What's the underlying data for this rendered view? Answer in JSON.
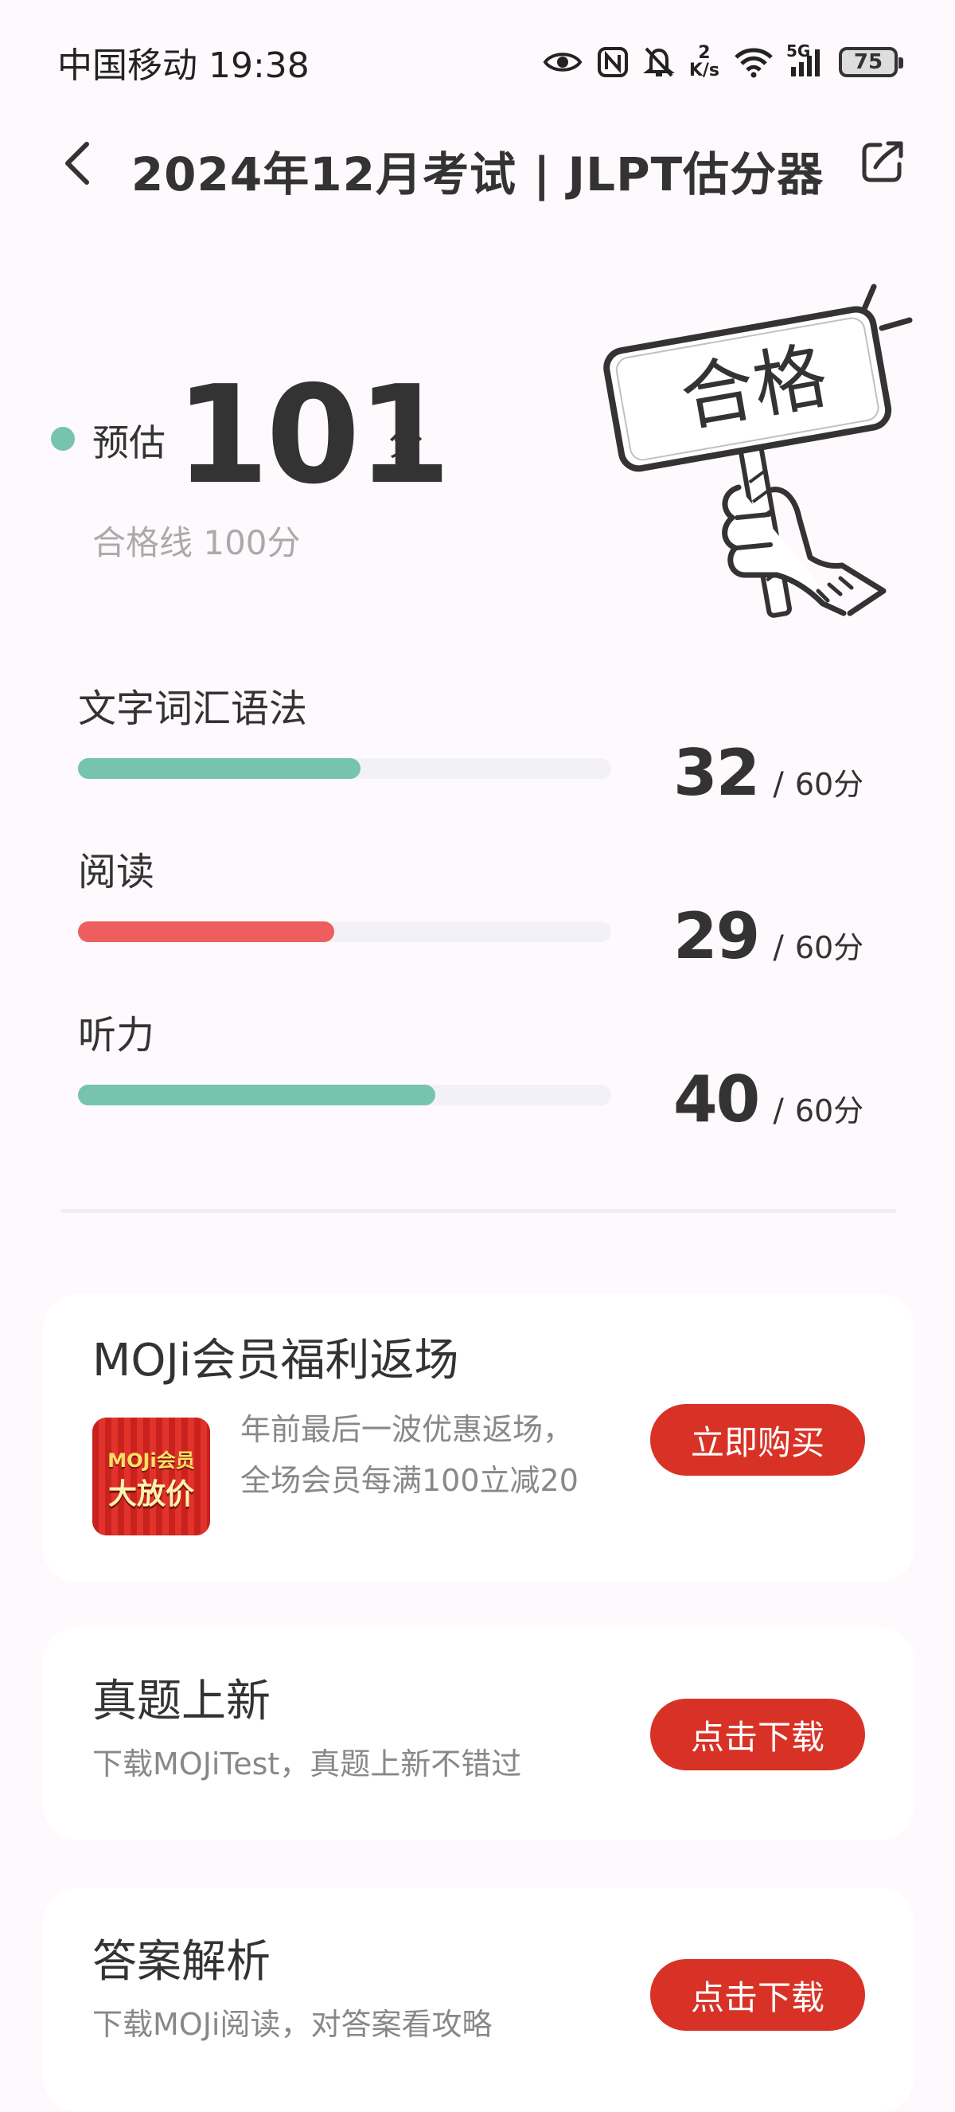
{
  "status_bar": {
    "carrier_time": "中国移动 19:38",
    "net_speed_value": "2",
    "net_speed_unit": "K/s",
    "signal_type": "5G",
    "battery": "75",
    "icons": [
      "eye-icon",
      "nfc-icon",
      "bell-off-icon",
      "wifi-icon",
      "signal-icon",
      "battery-icon"
    ]
  },
  "nav": {
    "title": "2024年12月考试 | JLPT估分器",
    "icons": [
      "back-arrow-icon",
      "share-icon"
    ]
  },
  "score": {
    "prefix": "预估",
    "value": "101",
    "unit": "分",
    "pass_line": "合格线 100分",
    "sign_text": "合格"
  },
  "sections": [
    {
      "name": "文字词汇语法",
      "score": "32",
      "max": "60分",
      "fraction": 0.53,
      "color": "#76c4ad"
    },
    {
      "name": "阅读",
      "score": "29",
      "max": "60分",
      "fraction": 0.48,
      "color": "#ee5e5e"
    },
    {
      "name": "听力",
      "score": "40",
      "max": "60分",
      "fraction": 0.67,
      "color": "#76c4ad"
    }
  ],
  "cards": {
    "promo": {
      "title": "MOJi会员福利返场",
      "desc": "年前最后一波优惠返场，全场会员每满100立减20",
      "thumb_line1": "MOJi会员",
      "thumb_line2": "大放价",
      "button": "立即购买"
    },
    "exam": {
      "title": "真题上新",
      "desc": "下载MOJiTest，真题上新不错过",
      "button": "点击下载"
    },
    "answers": {
      "title": "答案解析",
      "desc": "下载MOJi阅读，对答案看攻略",
      "button": "点击下载"
    }
  },
  "colors": {
    "accent_green": "#76c4ad",
    "accent_red": "#ee5e5e",
    "button_red": "#d83227"
  }
}
